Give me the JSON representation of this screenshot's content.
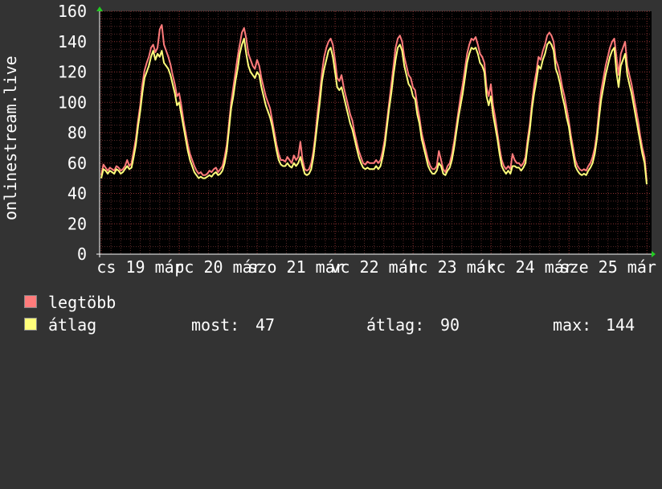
{
  "chart_data": {
    "type": "line",
    "ylabel": "onlinestream.live",
    "ylim": [
      0,
      160
    ],
    "yticks": [
      0,
      20,
      40,
      60,
      80,
      100,
      120,
      140,
      160
    ],
    "xtick_labels": [
      "cs 19 már",
      "pc 20 már",
      "szo 21 már",
      "vc 22 már",
      "hc 23 már",
      "kc 24 már",
      "sze 25 már"
    ],
    "grid": true,
    "series": [
      {
        "name": "legtöbb",
        "color": "#ff7b7b",
        "values": [
          52,
          59,
          57,
          55,
          57,
          56,
          55,
          58,
          57,
          55,
          56,
          58,
          62,
          58,
          60,
          68,
          76,
          88,
          98,
          112,
          121,
          126,
          130,
          136,
          138,
          133,
          136,
          148,
          151,
          138,
          134,
          130,
          125,
          118,
          112,
          104,
          106,
          98,
          88,
          80,
          72,
          66,
          62,
          58,
          55,
          53,
          54,
          52,
          52,
          53,
          55,
          54,
          56,
          57,
          54,
          56,
          58,
          64,
          72,
          86,
          100,
          110,
          120,
          130,
          138,
          146,
          149,
          142,
          132,
          128,
          124,
          122,
          128,
          124,
          116,
          110,
          104,
          100,
          96,
          88,
          80,
          72,
          66,
          62,
          62,
          61,
          64,
          62,
          60,
          65,
          62,
          64,
          74,
          62,
          56,
          55,
          56,
          60,
          68,
          80,
          94,
          106,
          120,
          130,
          136,
          140,
          142,
          138,
          128,
          116,
          114,
          118,
          110,
          104,
          98,
          92,
          88,
          80,
          74,
          68,
          64,
          60,
          59,
          61,
          60,
          60,
          60,
          62,
          60,
          62,
          68,
          76,
          88,
          100,
          112,
          124,
          136,
          142,
          144,
          140,
          130,
          124,
          118,
          116,
          110,
          108,
          98,
          90,
          80,
          74,
          68,
          62,
          58,
          56,
          56,
          58,
          68,
          62,
          56,
          54,
          58,
          60,
          66,
          74,
          84,
          94,
          104,
          112,
          122,
          132,
          138,
          142,
          141,
          143,
          138,
          132,
          130,
          126,
          110,
          104,
          112,
          98,
          90,
          80,
          70,
          62,
          58,
          56,
          58,
          56,
          66,
          62,
          60,
          60,
          58,
          60,
          64,
          76,
          86,
          100,
          112,
          120,
          130,
          128,
          134,
          138,
          144,
          146,
          144,
          140,
          128,
          124,
          118,
          110,
          104,
          96,
          88,
          78,
          70,
          62,
          58,
          56,
          55,
          56,
          55,
          58,
          60,
          64,
          70,
          80,
          96,
          108,
          116,
          124,
          130,
          136,
          140,
          142,
          130,
          118,
          132,
          136,
          140,
          124,
          118,
          112,
          104,
          96,
          88,
          78,
          70,
          64,
          48
        ]
      },
      {
        "name": "átlag",
        "color": "#ffff7b",
        "values": [
          50,
          56,
          55,
          53,
          55,
          54,
          53,
          56,
          55,
          53,
          54,
          56,
          58,
          56,
          57,
          64,
          72,
          84,
          94,
          106,
          116,
          120,
          124,
          130,
          134,
          128,
          132,
          130,
          134,
          126,
          124,
          122,
          118,
          112,
          106,
          98,
          100,
          92,
          84,
          76,
          68,
          62,
          58,
          54,
          52,
          50,
          51,
          50,
          50,
          51,
          52,
          51,
          53,
          54,
          52,
          53,
          55,
          60,
          68,
          82,
          96,
          104,
          114,
          122,
          132,
          138,
          142,
          132,
          124,
          120,
          118,
          116,
          120,
          118,
          110,
          104,
          98,
          94,
          90,
          84,
          76,
          68,
          62,
          59,
          58,
          58,
          60,
          58,
          57,
          60,
          58,
          60,
          64,
          58,
          53,
          52,
          53,
          56,
          64,
          76,
          88,
          100,
          114,
          122,
          128,
          134,
          136,
          130,
          120,
          110,
          108,
          110,
          104,
          98,
          92,
          86,
          82,
          76,
          70,
          64,
          60,
          57,
          56,
          57,
          56,
          56,
          56,
          58,
          56,
          58,
          64,
          72,
          84,
          96,
          106,
          118,
          128,
          136,
          138,
          134,
          124,
          118,
          112,
          110,
          104,
          102,
          92,
          86,
          76,
          70,
          64,
          58,
          55,
          53,
          53,
          55,
          60,
          58,
          53,
          52,
          55,
          57,
          62,
          70,
          80,
          90,
          98,
          106,
          116,
          126,
          132,
          136,
          135,
          136,
          132,
          126,
          124,
          120,
          104,
          98,
          104,
          92,
          84,
          76,
          66,
          58,
          55,
          53,
          55,
          53,
          58,
          58,
          57,
          57,
          55,
          57,
          60,
          72,
          82,
          96,
          106,
          114,
          124,
          122,
          128,
          132,
          138,
          140,
          138,
          134,
          122,
          118,
          112,
          104,
          98,
          90,
          84,
          74,
          66,
          58,
          55,
          53,
          52,
          53,
          52,
          55,
          57,
          60,
          66,
          76,
          90,
          102,
          110,
          118,
          124,
          130,
          134,
          136,
          120,
          110,
          124,
          128,
          132,
          118,
          112,
          106,
          98,
          90,
          82,
          74,
          66,
          60,
          46
        ]
      }
    ]
  },
  "legend": {
    "max_label": "legtöbb",
    "avg_label": "átlag",
    "current_label": "most:",
    "current_value": "47",
    "avg_stat_label": "átlag:",
    "avg_stat_value": "90",
    "max_stat_label": "max:",
    "max_stat_value": "144"
  }
}
